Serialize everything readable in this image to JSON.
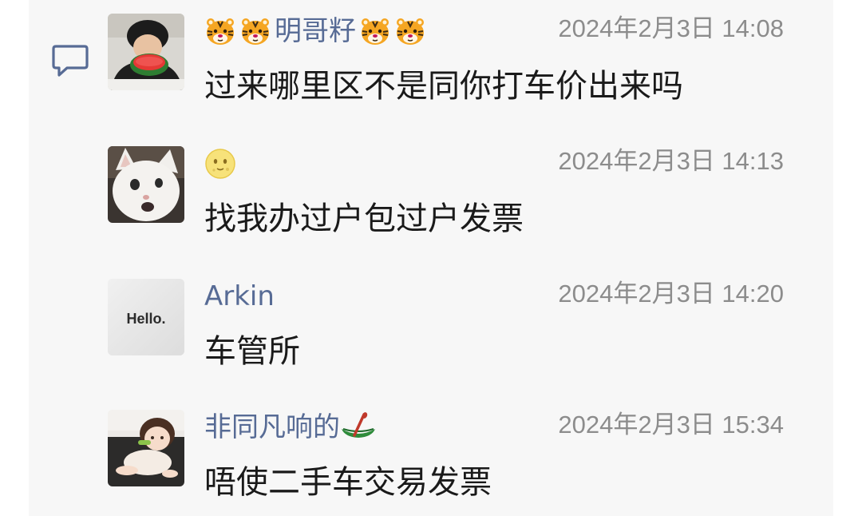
{
  "messages": [
    {
      "name": "明哥籽",
      "time": "2024年2月3日 14:08",
      "text": "过来哪里区不是同你打车价出来吗",
      "avatar_icon": "man-eating-watermelon-photo",
      "name_emojis": [
        "tiger-face-emoji",
        "tiger-face-emoji",
        "tiger-face-emoji",
        "tiger-face-emoji"
      ]
    },
    {
      "name": "",
      "time": "2024年2月3日 14:13",
      "text": "找我办过户包过户发票",
      "avatar_icon": "white-cat-photo",
      "name_emojis": [
        "moon-face-emoji"
      ]
    },
    {
      "name": "Arkin",
      "time": "2024年2月3日 14:20",
      "text": "车管所",
      "avatar_icon": "hello-card-photo",
      "avatar_text": "Hello."
    },
    {
      "name": "非同凡响的",
      "time": "2024年2月3日 15:34",
      "text": "唔使二手车交易发票",
      "avatar_icon": "baby-doll-photo",
      "name_emojis": [
        "canoe-emoji"
      ]
    }
  ],
  "colors": {
    "name": "#576b95",
    "time": "#8c8c8c",
    "text": "#1a1a1a",
    "panel_bg": "#f7f7f7"
  },
  "side_icon": "comment-icon"
}
